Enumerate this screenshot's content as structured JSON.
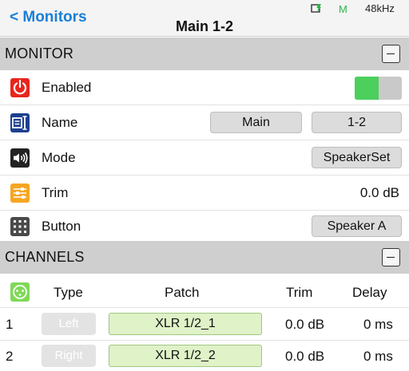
{
  "header": {
    "back_label": "< Monitors",
    "title": "Main 1-2",
    "m_status": "M",
    "sample_rate": "48kHz"
  },
  "monitor_section": {
    "label": "MONITOR",
    "rows": {
      "enabled": {
        "label": "Enabled",
        "toggle_on": true
      },
      "name": {
        "label": "Name",
        "values": [
          "Main",
          "1-2"
        ]
      },
      "mode": {
        "label": "Mode",
        "value": "SpeakerSet"
      },
      "trim": {
        "label": "Trim",
        "value": "0.0 dB"
      },
      "button": {
        "label": "Button",
        "value": "Speaker A"
      }
    }
  },
  "channels_section": {
    "label": "CHANNELS",
    "columns": [
      "Type",
      "Patch",
      "Trim",
      "Delay"
    ],
    "rows": [
      {
        "index": "1",
        "type": "Left",
        "patch": "XLR 1/2_1",
        "trim": "0.0 dB",
        "delay": "0 ms"
      },
      {
        "index": "2",
        "type": "Right",
        "patch": "XLR 1/2_2",
        "trim": "0.0 dB",
        "delay": "0 ms"
      }
    ]
  },
  "colors": {
    "accent_blue": "#1a7fd6",
    "power_red": "#e8251c",
    "name_blue": "#1d3f8f",
    "trim_orange": "#f6a623",
    "toggle_green": "#4ccf5c",
    "patch_green": "#dff2c8",
    "channels_icon_green": "#7ed957"
  },
  "icons": {
    "clock": "clock-charging-icon",
    "power": "power-icon",
    "name": "name-tag-icon",
    "mode": "speaker-icon",
    "trim": "sliders-icon",
    "button": "keypad-icon",
    "channels": "channels-icon"
  }
}
